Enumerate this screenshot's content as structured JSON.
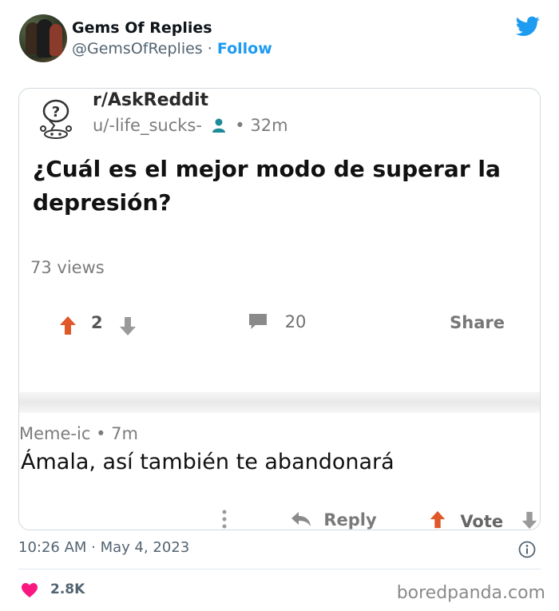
{
  "tweet": {
    "author_name": "Gems Of Replies",
    "handle": "@GemsOfReplies",
    "separator": "·",
    "follow_label": "Follow",
    "timestamp": "10:26 AM · May 4, 2023",
    "likes": "2.8K",
    "brand_color": "#1d9bf0",
    "like_color": "#f91880"
  },
  "reddit_post": {
    "subreddit": "r/AskReddit",
    "user": "u/-life_sucks-",
    "age": "• 32m",
    "question": "¿Cuál es el mejor modo de superar la depresión?",
    "views": "73 views",
    "score": "2",
    "comments": "20",
    "share_label": "Share",
    "upvote_color": "#e0572a"
  },
  "reddit_reply": {
    "commenter": "Meme-ic",
    "age": "• 7m",
    "text": "Ámala, así también te abandonará",
    "reply_label": "Reply",
    "vote_label": "Vote"
  },
  "watermark": "boredpanda.com",
  "icons": [
    "twitter-bird-icon",
    "reddit-question-icon",
    "user-icon",
    "upvote-icon",
    "downvote-icon",
    "comment-icon",
    "more-dots-icon",
    "reply-icon",
    "info-icon",
    "heart-icon"
  ]
}
